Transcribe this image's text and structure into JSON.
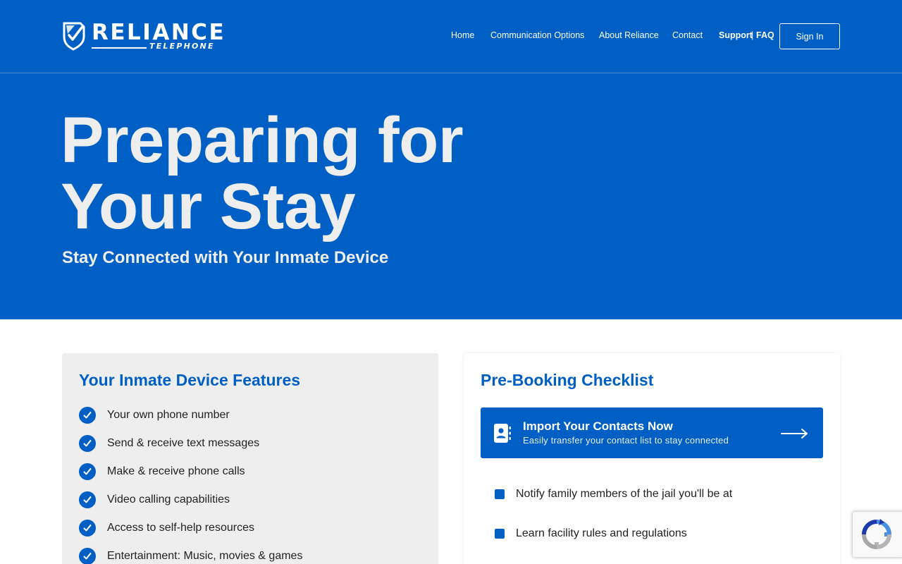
{
  "header": {
    "logo": {
      "name": "RELIANCE",
      "sub": "TELEPHONE",
      "icon": "shield-check-icon"
    },
    "nav": [
      {
        "label": "Home"
      },
      {
        "label": "Communication Options"
      },
      {
        "label": "About Reliance"
      },
      {
        "label": "Contact"
      },
      {
        "label": "Support"
      },
      {
        "label": "FAQ"
      }
    ],
    "separator": "|",
    "sign_in": "Sign In"
  },
  "hero": {
    "title_line1": "Preparing for",
    "title_line2": "Your Stay",
    "subtitle": "Stay Connected with Your Inmate Device"
  },
  "features": {
    "title": "Your Inmate Device Features",
    "items": [
      {
        "label": "Your own phone number"
      },
      {
        "label": "Send & receive text messages"
      },
      {
        "label": "Make & receive phone calls"
      },
      {
        "label": "Video calling capabilities"
      },
      {
        "label": "Access to self-help resources"
      },
      {
        "label": "Entertainment: Music, movies & games"
      }
    ]
  },
  "checklist": {
    "title": "Pre-Booking Checklist",
    "import": {
      "title": "Import Your Contacts Now",
      "subtitle": "Easily transfer your contact list to stay connected",
      "icon": "contact-book-icon"
    },
    "items": [
      {
        "label": "Notify family members of the jail you'll be at"
      },
      {
        "label": "Learn facility rules and regulations"
      }
    ]
  },
  "colors": {
    "brand_blue": "#005fc4",
    "hero_text": "#eeeeee",
    "feature_card_bg": "#eeeeee"
  }
}
